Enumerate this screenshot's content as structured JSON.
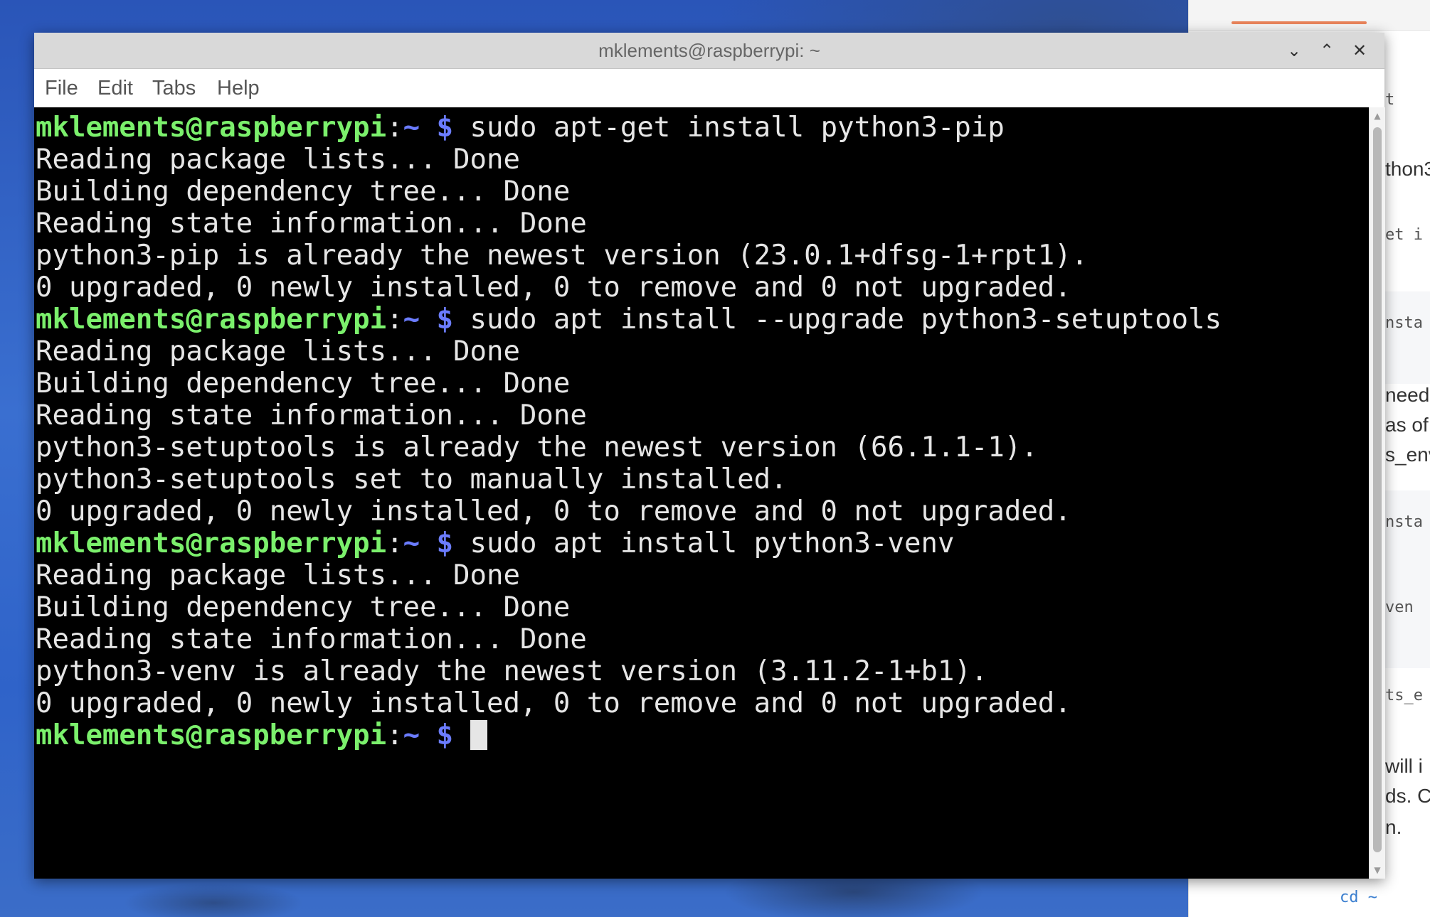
{
  "window": {
    "title": "mklements@raspberrypi: ~",
    "controls": {
      "minimize_icon": "⌄",
      "maximize_icon": "⌃",
      "close_icon": "✕"
    }
  },
  "menu": {
    "items": [
      "File",
      "Edit",
      "Tabs",
      "Help"
    ]
  },
  "terminal": {
    "prompt": {
      "user_host": "mklements@raspberrypi",
      "separator": ":",
      "path": "~",
      "symbol": "$"
    },
    "lines": [
      {
        "type": "prompt",
        "command": "sudo apt-get install python3-pip"
      },
      {
        "type": "output",
        "text": "Reading package lists... Done"
      },
      {
        "type": "output",
        "text": "Building dependency tree... Done"
      },
      {
        "type": "output",
        "text": "Reading state information... Done"
      },
      {
        "type": "output",
        "text": "python3-pip is already the newest version (23.0.1+dfsg-1+rpt1)."
      },
      {
        "type": "output",
        "text": "0 upgraded, 0 newly installed, 0 to remove and 0 not upgraded."
      },
      {
        "type": "prompt",
        "command": "sudo apt install --upgrade python3-setuptools"
      },
      {
        "type": "output",
        "text": "Reading package lists... Done"
      },
      {
        "type": "output",
        "text": "Building dependency tree... Done"
      },
      {
        "type": "output",
        "text": "Reading state information... Done"
      },
      {
        "type": "output",
        "text": "python3-setuptools is already the newest version (66.1.1-1)."
      },
      {
        "type": "output",
        "text": "python3-setuptools set to manually installed."
      },
      {
        "type": "output",
        "text": "0 upgraded, 0 newly installed, 0 to remove and 0 not upgraded."
      },
      {
        "type": "prompt",
        "command": "sudo apt install python3-venv"
      },
      {
        "type": "output",
        "text": "Reading package lists... Done"
      },
      {
        "type": "output",
        "text": "Building dependency tree... Done"
      },
      {
        "type": "output",
        "text": "Reading state information... Done"
      },
      {
        "type": "output",
        "text": "python3-venv is already the newest version (3.11.2-1+b1)."
      },
      {
        "type": "output",
        "text": "0 upgraded, 0 newly installed, 0 to remove and 0 not upgraded."
      },
      {
        "type": "prompt",
        "command": "",
        "cursor": true
      }
    ],
    "colors": {
      "prompt_user": "#7bf06c",
      "prompt_symbol": "#6b7cff",
      "text": "#e6e6e6",
      "background": "#000000"
    }
  },
  "background_window": {
    "fragments": [
      {
        "text": "t",
        "style": "code"
      },
      {
        "text": "thon3",
        "style": "prose"
      },
      {
        "text": "et i",
        "style": "code"
      },
      {
        "text": "nsta",
        "style": "code"
      },
      {
        "text": "need",
        "style": "prose"
      },
      {
        "text": "as of",
        "style": "prose"
      },
      {
        "text": "s_env",
        "style": "prose"
      },
      {
        "text": "nsta",
        "style": "code"
      },
      {
        "text": "ven",
        "style": "code"
      },
      {
        "text": "ts_e",
        "style": "code"
      },
      {
        "text": "will i",
        "style": "prose"
      },
      {
        "text": "ds. C",
        "style": "prose"
      },
      {
        "text": "n.",
        "style": "prose"
      },
      {
        "text": "cd ~",
        "style": "link"
      }
    ]
  }
}
